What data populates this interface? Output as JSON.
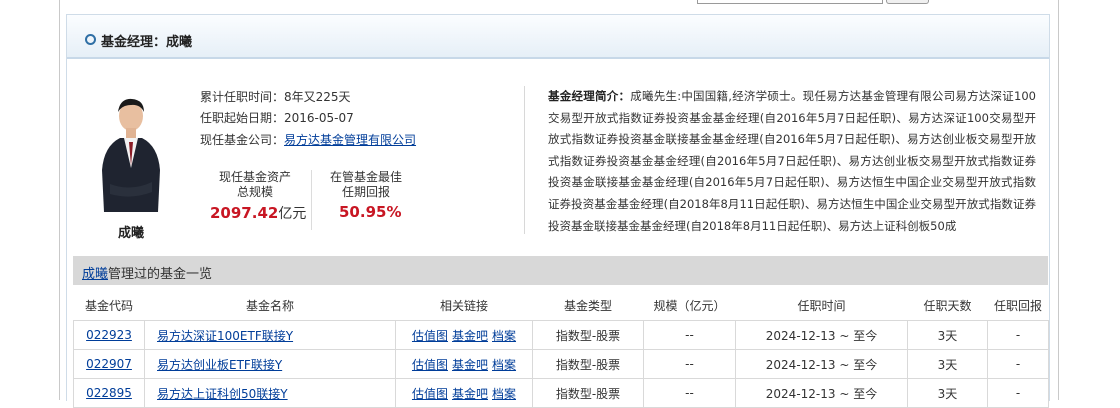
{
  "panel": {
    "title": "基金经理：成曦"
  },
  "manager": {
    "name": "成曦",
    "tenure": "累计任职时间：8年又225天",
    "start_date": "任职起始日期：2016-05-07",
    "company_label": "现任基金公司：",
    "company": "易方达基金管理有限公司",
    "aum_label_1": "现任基金资产",
    "aum_label_2": "总规模",
    "aum_value": "2097.42",
    "aum_unit": "亿元",
    "ret_label_1": "在管基金最佳",
    "ret_label_2": "任期回报",
    "ret_value": "50.95%",
    "bio_label": "基金经理简介：",
    "bio_text": "成曦先生:中国国籍,经济学硕士。现任易方达基金管理有限公司易方达深证100交易型开放式指数证券投资基金基金经理(自2016年5月7日起任职)、易方达深证100交易型开放式指数证券投资基金联接基金基金经理(自2016年5月7日起任职)、易方达创业板交易型开放式指数证券投资基金基金经理(自2016年5月7日起任职)、易方达创业板交易型开放式指数证券投资基金联接基金基金经理(自2016年5月7日起任职)、易方达恒生中国企业交易型开放式指数证券投资基金基金经理(自2018年8月11日起任职)、易方达恒生中国企业交易型开放式指数证券投资基金联接基金基金经理(自2018年8月11日起任职)、易方达上证科创板50成"
  },
  "list": {
    "name_link": "成曦",
    "title_suffix": "管理过的基金一览"
  },
  "table": {
    "headers": [
      "基金代码",
      "基金名称",
      "相关链接",
      "基金类型",
      "规模（亿元）",
      "任职时间",
      "任职天数",
      "任职回报"
    ],
    "rows": [
      {
        "code": "022923",
        "name": "易方达深证100ETF联接Y",
        "links": [
          "估值图",
          "基金吧",
          "档案"
        ],
        "type": "指数型-股票",
        "scale": "--",
        "period": "2024-12-13 ~ 至今",
        "days": "3天",
        "ret": "-"
      },
      {
        "code": "022907",
        "name": "易方达创业板ETF联接Y",
        "links": [
          "估值图",
          "基金吧",
          "档案"
        ],
        "type": "指数型-股票",
        "scale": "--",
        "period": "2024-12-13 ~ 至今",
        "days": "3天",
        "ret": "-"
      },
      {
        "code": "022895",
        "name": "易方达上证科创50联接Y",
        "links": [
          "估值图",
          "基金吧",
          "档案"
        ],
        "type": "指数型-股票",
        "scale": "--",
        "period": "2024-12-13 ~ 至今",
        "days": "3天",
        "ret": "-"
      }
    ]
  }
}
